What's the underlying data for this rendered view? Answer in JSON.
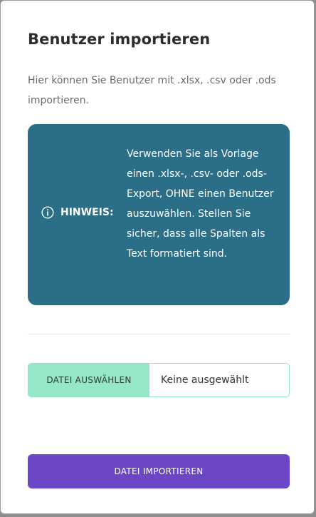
{
  "dialog": {
    "title": "Benutzer importieren",
    "description": "Hier können Sie Benutzer mit .xlsx, .csv oder .ods importieren."
  },
  "hint": {
    "icon": "info-icon",
    "label": "HINWEIS:",
    "text": "Verwenden Sie als Vorlage einen .xlsx-, .csv- oder .ods-Export, OHNE einen Benutzer auszuwählen. Stellen Sie sicher, dass alle Spalten als Text formatiert sind.",
    "background_color": "#2b6e88"
  },
  "file_picker": {
    "button_label": "DATEI AUSWÄHLEN",
    "status": "Keine ausgewählt",
    "accent_color": "#95e8c7"
  },
  "import_button": {
    "label": "DATEI IMPORTIEREN",
    "color": "#6b47c8"
  }
}
